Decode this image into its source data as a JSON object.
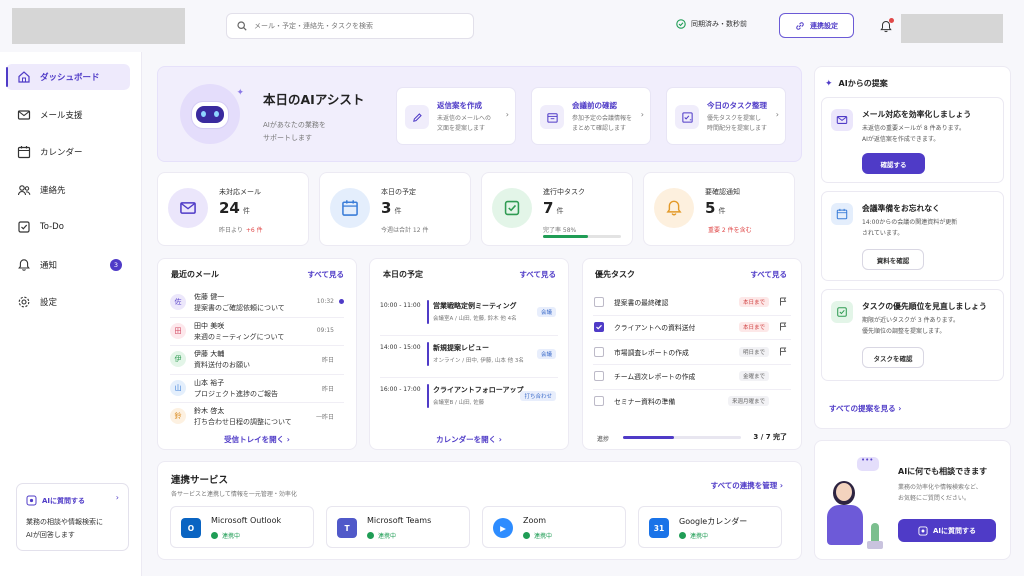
{
  "header": {
    "search_placeholder": "メール・予定・連絡先・タスクを検索",
    "sync_status": "同期済み・数秒前",
    "connect_button": "連携設定",
    "colors": {
      "accent": "#4f3bc7",
      "success": "#1f9d55",
      "danger": "#e04848",
      "badge": "#4f3bc7"
    }
  },
  "sidebar": {
    "items": [
      {
        "label": "ダッシュボード",
        "icon": "home-icon",
        "active": true
      },
      {
        "label": "メール支援",
        "icon": "mail-icon"
      },
      {
        "label": "カレンダー",
        "icon": "calendar-icon"
      },
      {
        "label": "連絡先",
        "icon": "contacts-icon"
      },
      {
        "label": "To-Do",
        "icon": "checkbox-icon"
      },
      {
        "label": "通知",
        "icon": "bell-icon",
        "badge": "3"
      },
      {
        "label": "設定",
        "icon": "gear-icon"
      }
    ],
    "ai_box": {
      "title": "AIに質問する",
      "desc_line1": "業務の相談や情報検索に",
      "desc_line2": "AIが回答します"
    }
  },
  "hero": {
    "title": "本日のAIアシスト",
    "sub_line1": "AIがあなたの業務を",
    "sub_line2": "サポートします",
    "actions": [
      {
        "title": "返信案を作成",
        "line1": "未返信のメールへの",
        "line2": "文面を提案します"
      },
      {
        "title": "会議前の確認",
        "line1": "参加予定の会議情報を",
        "line2": "まとめて確認します"
      },
      {
        "title": "今日のタスク整理",
        "line1": "優先タスクを提案し",
        "line2": "時間配分を提案します"
      }
    ]
  },
  "stats": [
    {
      "label": "未対応メール",
      "value": "24",
      "unit": "件",
      "note_prefix": "昨日より",
      "note_value": "+6 件"
    },
    {
      "label": "本日の予定",
      "value": "3",
      "unit": "件",
      "note_prefix": "今週は合計 12 件",
      "note_value": ""
    },
    {
      "label": "進行中タスク",
      "value": "7",
      "unit": "件",
      "note_prefix": "完了率 58%",
      "note_value": "",
      "progress": 0.58
    },
    {
      "label": "要確認通知",
      "value": "5",
      "unit": "件",
      "note_prefix": "",
      "note_value": "重要 2 件を含む"
    }
  ],
  "mail": {
    "title": "最近のメール",
    "see_all": "すべて見る",
    "items": [
      {
        "initial": "佐",
        "name": "佐藤 健一",
        "subject": "提案書のご確認依頼について",
        "time": "10:32",
        "unread": true,
        "color": "#ece7fb",
        "fg": "#5b45c9"
      },
      {
        "initial": "田",
        "name": "田中 美咲",
        "subject": "来週のミーティングについて",
        "time": "09:15",
        "color": "#fde8ec",
        "fg": "#d0435d"
      },
      {
        "initial": "伊",
        "name": "伊藤 大輔",
        "subject": "資料送付のお願い",
        "time": "昨日",
        "color": "#e3f5e8",
        "fg": "#2f9b52"
      },
      {
        "initial": "山",
        "name": "山本 裕子",
        "subject": "プロジェクト進捗のご報告",
        "time": "昨日",
        "color": "#e4effc",
        "fg": "#3b7dd8"
      },
      {
        "initial": "鈴",
        "name": "鈴木 啓太",
        "subject": "打ち合わせ日程の調整について",
        "time": "一昨日",
        "color": "#fdf1e1",
        "fg": "#d98a1f"
      }
    ],
    "footer": "受信トレイを開く"
  },
  "schedule": {
    "title": "本日の予定",
    "see_all": "すべて見る",
    "items": [
      {
        "time": "10:00 - 11:00",
        "title": "営業戦略定例ミーティング",
        "meta": "会議室A / 山田, 佐藤, 鈴木 他 4名",
        "tag": "会議"
      },
      {
        "time": "14:00 - 15:00",
        "title": "新規提案レビュー",
        "meta": "オンライン / 田中, 伊藤, 山本 他 3名",
        "tag": "会議"
      },
      {
        "time": "16:00 - 17:00",
        "title": "クライアントフォローアップ",
        "meta": "会議室B / 山田, 佐藤",
        "tag": "打ち合わせ"
      }
    ],
    "footer": "カレンダーを開く"
  },
  "tasks": {
    "title": "優先タスク",
    "see_all": "すべて見る",
    "items": [
      {
        "title": "提案書の最終確認",
        "due": "本日まで",
        "checked": false,
        "flag": true,
        "urgent": true
      },
      {
        "title": "クライアントへの資料送付",
        "due": "本日まで",
        "checked": true,
        "flag": true,
        "urgent": true
      },
      {
        "title": "市場調査レポートの作成",
        "due": "明日まで",
        "checked": false,
        "flag": true
      },
      {
        "title": "チーム週次レポートの作成",
        "due": "金曜まで",
        "checked": false
      },
      {
        "title": "セミナー資料の準備",
        "due": "来週月曜まで",
        "checked": false
      }
    ],
    "progress_label": "進捗",
    "progress_text": "3 / 7 完了",
    "progress": 0.43
  },
  "services": {
    "title": "連携サービス",
    "subtitle": "各サービスと連携して情報を一元管理・効率化",
    "manage": "すべての連携を管理",
    "items": [
      {
        "name": "Microsoft Outlook",
        "status": "連携中",
        "icon": "outlook-icon",
        "color": "#0a64c2"
      },
      {
        "name": "Microsoft Teams",
        "status": "連携中",
        "icon": "teams-icon",
        "color": "#5059c9"
      },
      {
        "name": "Zoom",
        "status": "連携中",
        "icon": "zoom-icon",
        "color": "#2d8cff"
      },
      {
        "name": "Googleカレンダー",
        "status": "連携中",
        "icon": "google-calendar-icon",
        "color": "#1a73e8"
      }
    ]
  },
  "suggestions": {
    "title": "AIからの提案",
    "items": [
      {
        "title": "メール対応を効率化しましょう",
        "line1": "未返信の重要メールが 8 件あります。",
        "line2": "AIが返信案を作成できます。",
        "button": "確認する",
        "primary": true
      },
      {
        "title": "会議準備をお忘れなく",
        "line1": "14:00からの会議の関連資料が更新",
        "line2": "されています。",
        "button": "資料を確認"
      },
      {
        "title": "タスクの優先順位を見直しましょう",
        "line1": "期限が近いタスクが 3 件あります。",
        "line2": "優先順位の調整を提案します。",
        "button": "タスクを確認"
      }
    ],
    "see_all": "すべての提案を見る"
  },
  "ask": {
    "title": "AIに何でも相談できます",
    "line1": "業務の効率化や情報検索など、",
    "line2": "お気軽にご質問ください。",
    "button": "AIに質問する"
  }
}
